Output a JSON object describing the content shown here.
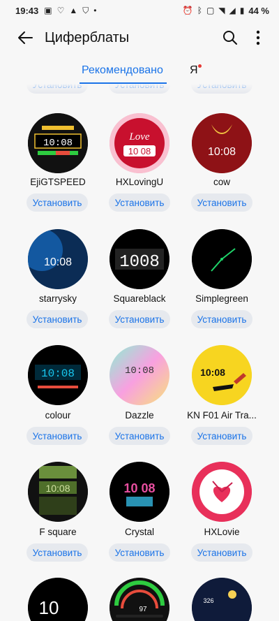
{
  "status": {
    "time": "19:43",
    "battery": "44 %"
  },
  "appbar": {
    "title": "Циферблаты"
  },
  "tabs": [
    {
      "label": "Рекомендовано"
    },
    {
      "label": "Я"
    }
  ],
  "install_label": "Установить",
  "faces": [
    {
      "name": "EjiGTSPEED",
      "face_text": "10:08"
    },
    {
      "name": "HXLovingU",
      "face_text": "Love"
    },
    {
      "name": "cow",
      "face_text": "10:08"
    },
    {
      "name": "starrysky",
      "face_text": "10:08"
    },
    {
      "name": "Squareblack",
      "face_text": "1008"
    },
    {
      "name": "Simplegreen",
      "face_text": ""
    },
    {
      "name": "colour",
      "face_text": "10:08"
    },
    {
      "name": "Dazzle",
      "face_text": "10:08"
    },
    {
      "name": "KN F01 Air Tra...",
      "face_text": "10:08"
    },
    {
      "name": "F square",
      "face_text": "10:08"
    },
    {
      "name": "Crystal",
      "face_text": "10 08"
    },
    {
      "name": "HXLovie",
      "face_text": ""
    },
    {
      "name": "",
      "face_text": "10"
    },
    {
      "name": "",
      "face_text": "97"
    },
    {
      "name": "",
      "face_text": "326"
    }
  ]
}
